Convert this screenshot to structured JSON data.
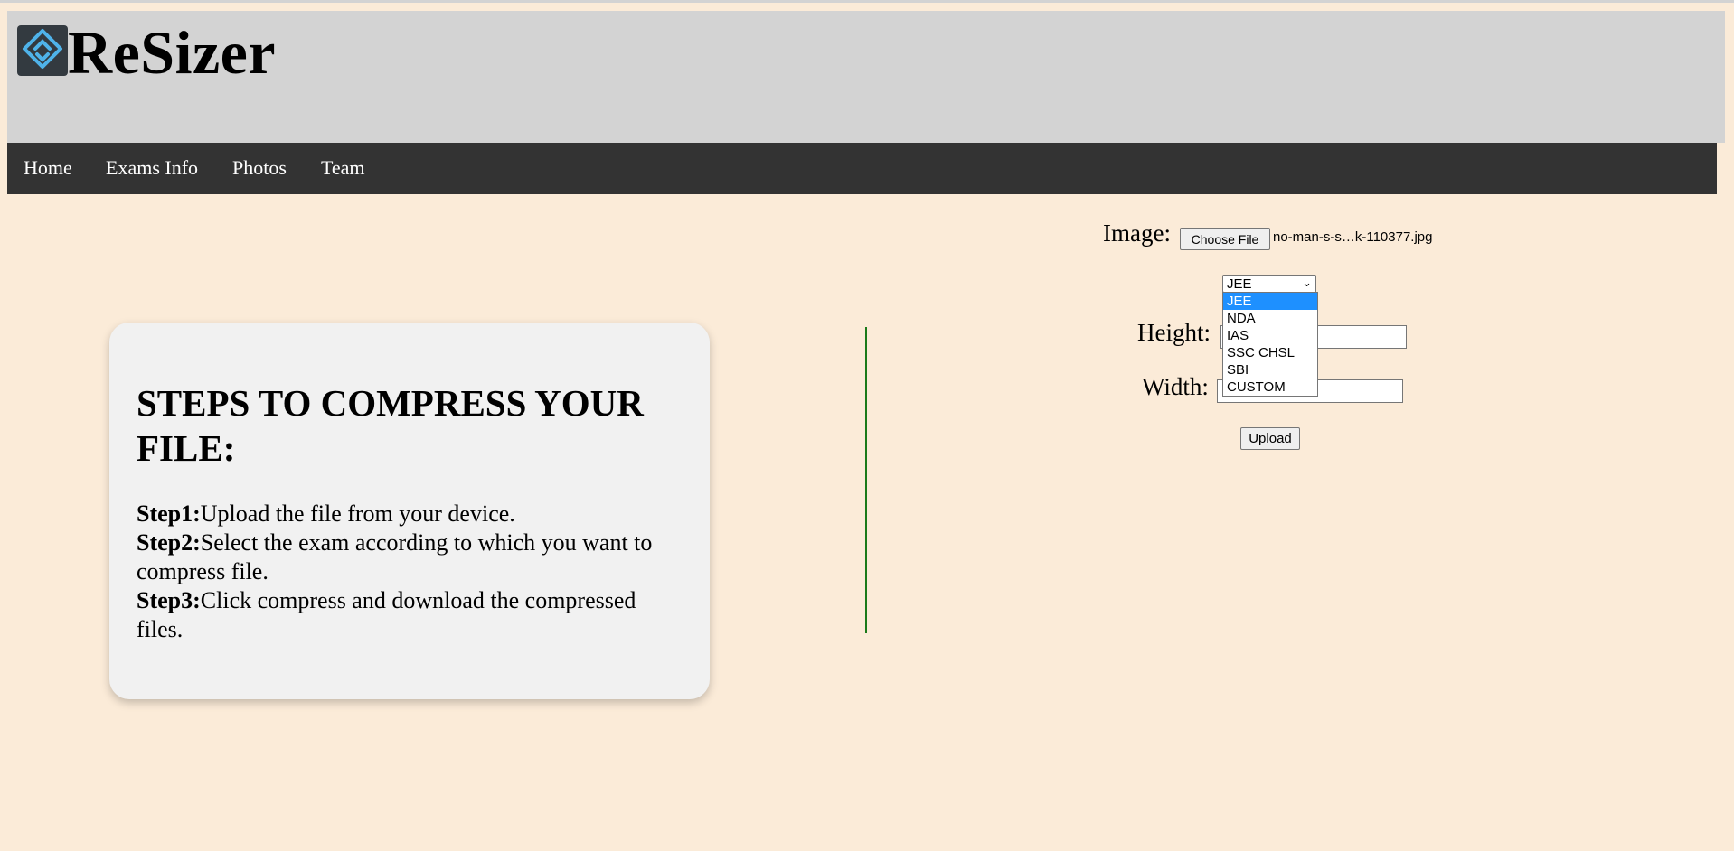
{
  "header": {
    "brand": "ReSizer",
    "logo_icon": "diamond-arrows-logo-icon",
    "colors": {
      "header_bg": "#d3d3d3",
      "logo_bg": "#333a40",
      "logo_accent": "#4fb3ea"
    }
  },
  "nav": {
    "items": [
      {
        "label": "Home"
      },
      {
        "label": "Exams Info"
      },
      {
        "label": "Photos"
      },
      {
        "label": "Team"
      }
    ],
    "colors": {
      "bg": "#333333",
      "text": "#ffffff"
    }
  },
  "steps_card": {
    "title": "STEPS TO COMPRESS YOUR FILE:",
    "steps": [
      {
        "label": "Step1:",
        "text": "Upload the file from your device."
      },
      {
        "label": "Step2:",
        "text": "Select the exam according to which you want to compress file."
      },
      {
        "label": "Step3:",
        "text": "Click compress and download the compressed files."
      }
    ]
  },
  "form": {
    "image_label": "Image:",
    "choose_file_label": "Choose File",
    "file_name": "no-man-s-s…k-110377.jpg",
    "exam_select": {
      "selected": "JEE",
      "options": [
        "JEE",
        "NDA",
        "IAS",
        "SSC CHSL",
        "SBI",
        "CUSTOM"
      ],
      "highlighted": "JEE"
    },
    "height_label": "Height:",
    "height_value": "",
    "width_label": "Width:",
    "width_value": "",
    "upload_label": "Upload"
  },
  "colors": {
    "page_bg": "#fbebd8",
    "divider": "#1a7a1a",
    "option_highlight": "#1e90ff"
  }
}
